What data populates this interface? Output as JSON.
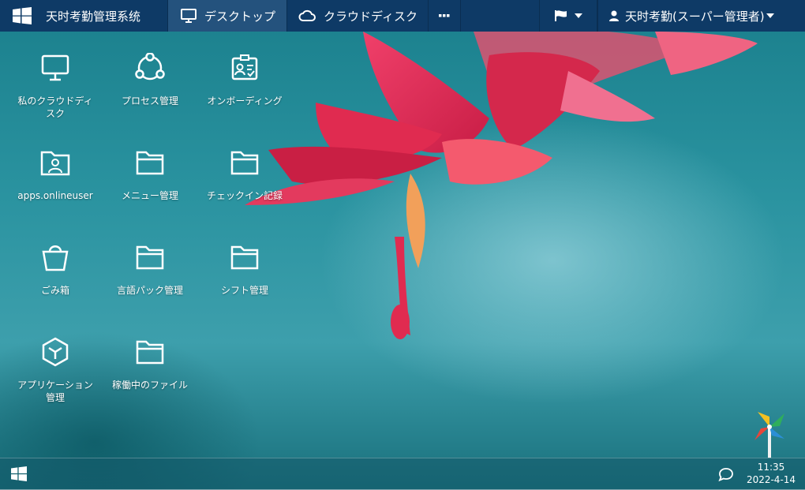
{
  "topbar": {
    "brand_title": "天时考勤管理系统",
    "tabs": [
      {
        "label": "デスクトップ",
        "icon": "monitor-icon",
        "active": true
      },
      {
        "label": "クラウドディスク",
        "icon": "cloud-icon",
        "active": false
      }
    ],
    "more_icon": "ellipsis-icon",
    "flag_icon": "flag-icon",
    "user_label": "天时考勤(スーパー管理者)",
    "user_icon": "user-icon"
  },
  "desktop": {
    "icons": [
      {
        "label": "私のクラウドディスク",
        "icon": "monitor-icon"
      },
      {
        "label": "プロセス管理",
        "icon": "process-icon"
      },
      {
        "label": "オンボーディング",
        "icon": "id-card-icon"
      },
      {
        "label": "apps.onlineuser",
        "icon": "user-folder-icon"
      },
      {
        "label": "メニュー管理",
        "icon": "folder-icon"
      },
      {
        "label": "チェックイン記録",
        "icon": "folder-icon"
      },
      {
        "label": "ごみ箱",
        "icon": "trash-icon"
      },
      {
        "label": "言語パック管理",
        "icon": "folder-icon"
      },
      {
        "label": "シフト管理",
        "icon": "folder-icon"
      },
      {
        "label": "アプリケーション管理",
        "icon": "cube-icon"
      },
      {
        "label": "稼働中のファイル",
        "icon": "folder-icon"
      }
    ]
  },
  "taskbar": {
    "start_icon": "windows-icon",
    "message_icon": "chat-icon",
    "time": "11:35",
    "date": "2022-4-14"
  },
  "colors": {
    "topbar": "#0e3a66",
    "active_tab": "#24527d",
    "wallpaper": "#2a93a0",
    "flower": "#e0284f"
  }
}
